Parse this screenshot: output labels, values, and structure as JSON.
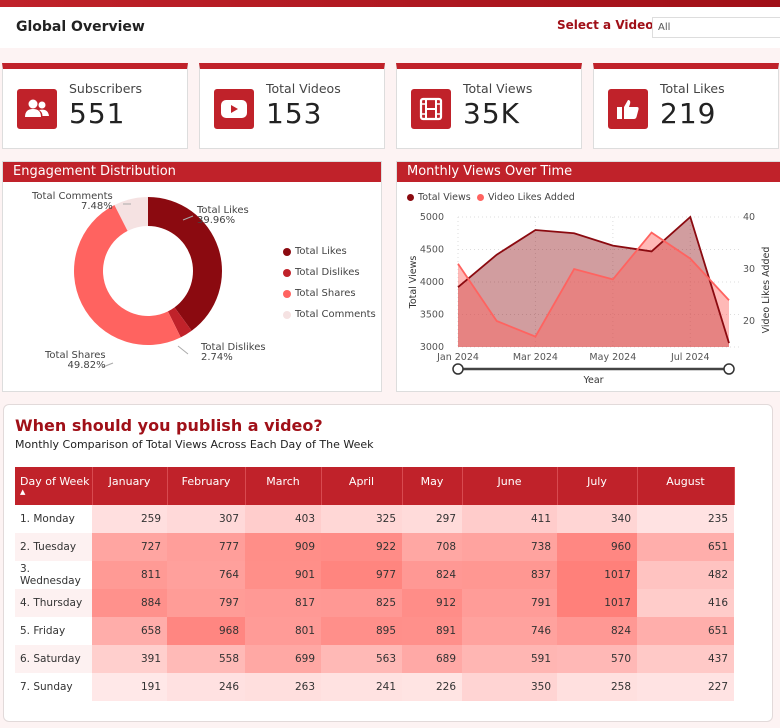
{
  "header": {
    "title": "Global Overview",
    "select_label": "Select a Video",
    "select_value": "All"
  },
  "kpis": [
    {
      "label": "Subscribers",
      "value": "551",
      "icon": "users-icon"
    },
    {
      "label": "Total Videos",
      "value": "153",
      "icon": "youtube-play-icon"
    },
    {
      "label": "Total Views",
      "value": "35K",
      "icon": "film-icon"
    },
    {
      "label": "Total Likes",
      "value": "219",
      "icon": "thumbs-up-icon"
    }
  ],
  "colors": {
    "accent": "#c0222a",
    "likes": "#8b0a10",
    "dislikes": "#c0222a",
    "shares": "#ff6360",
    "comments": "#f5e2e2",
    "views_line": "#8b0a10",
    "likes_added_line": "#ff6360"
  },
  "engagement": {
    "title": "Engagement Distribution",
    "labels": {
      "likes": "Total Likes",
      "likes_pct": "39.96%",
      "dislikes": "Total Dislikes",
      "dislikes_pct": "2.74%",
      "shares": "Total Shares",
      "shares_pct": "49.82%",
      "comments": "Total Comments",
      "comments_pct": "7.48%"
    },
    "legend": [
      "Total Likes",
      "Total Dislikes",
      "Total Shares",
      "Total Comments"
    ]
  },
  "monthly": {
    "title": "Monthly Views Over Time",
    "legend": [
      "Total Views",
      "Video Likes Added"
    ],
    "y_left_label": "Total Views",
    "y_right_label": "Video Likes Added",
    "x_label": "Year",
    "x_ticks": [
      "Jan 2024",
      "Mar 2024",
      "May 2024",
      "Jul 2024"
    ],
    "y_left_ticks": [
      "5000",
      "4500",
      "4000",
      "3500",
      "3000"
    ],
    "y_right_ticks": [
      "40",
      "30",
      "20"
    ]
  },
  "chart_data": [
    {
      "type": "pie",
      "title": "Engagement Distribution",
      "categories": [
        "Total Likes",
        "Total Dislikes",
        "Total Shares",
        "Total Comments"
      ],
      "values": [
        39.96,
        2.74,
        49.82,
        7.48
      ],
      "legend": "right"
    },
    {
      "type": "area",
      "title": "Monthly Views Over Time",
      "x": [
        "Jan 2024",
        "Feb 2024",
        "Mar 2024",
        "Apr 2024",
        "May 2024",
        "Jun 2024",
        "Jul 2024",
        "Aug 2024"
      ],
      "series": [
        {
          "name": "Total Views",
          "axis": "left",
          "values": [
            3920,
            4420,
            4800,
            4750,
            4560,
            4470,
            5000,
            3060
          ]
        },
        {
          "name": "Video Likes Added",
          "axis": "right",
          "values": [
            31,
            20,
            17,
            30,
            28,
            37,
            32,
            24
          ]
        }
      ],
      "xlabel": "Year",
      "ylabel": "Total Views",
      "y2label": "Video Likes Added",
      "ylim": [
        3000,
        5000
      ],
      "y2lim": [
        15,
        40
      ],
      "grid": true,
      "legend": "top-left"
    },
    {
      "type": "heatmap",
      "title": "When should you publish a video?",
      "subtitle": "Monthly Comparison of Total Views Across Each Day of The Week",
      "columns": [
        "Day of Week",
        "January",
        "February",
        "March",
        "April",
        "May",
        "June",
        "July",
        "August"
      ],
      "rows": [
        {
          "day": "1. Monday",
          "values": [
            259,
            307,
            403,
            325,
            297,
            411,
            340,
            235
          ]
        },
        {
          "day": "2. Tuesday",
          "values": [
            727,
            777,
            909,
            922,
            708,
            738,
            960,
            651
          ]
        },
        {
          "day": "3. Wednesday",
          "values": [
            811,
            764,
            901,
            977,
            824,
            837,
            1017,
            482
          ]
        },
        {
          "day": "4. Thursday",
          "values": [
            884,
            797,
            817,
            825,
            912,
            791,
            1017,
            416
          ]
        },
        {
          "day": "5. Friday",
          "values": [
            658,
            968,
            801,
            895,
            891,
            746,
            824,
            651
          ]
        },
        {
          "day": "6. Saturday",
          "values": [
            391,
            558,
            699,
            563,
            689,
            591,
            570,
            437
          ]
        },
        {
          "day": "7. Sunday",
          "values": [
            191,
            246,
            263,
            241,
            226,
            350,
            258,
            227
          ]
        }
      ]
    }
  ],
  "table": {
    "title": "When should you publish a video?",
    "subtitle": "Monthly Comparison of Total Views Across Each Day of The Week",
    "sort_indicator": "▲"
  }
}
